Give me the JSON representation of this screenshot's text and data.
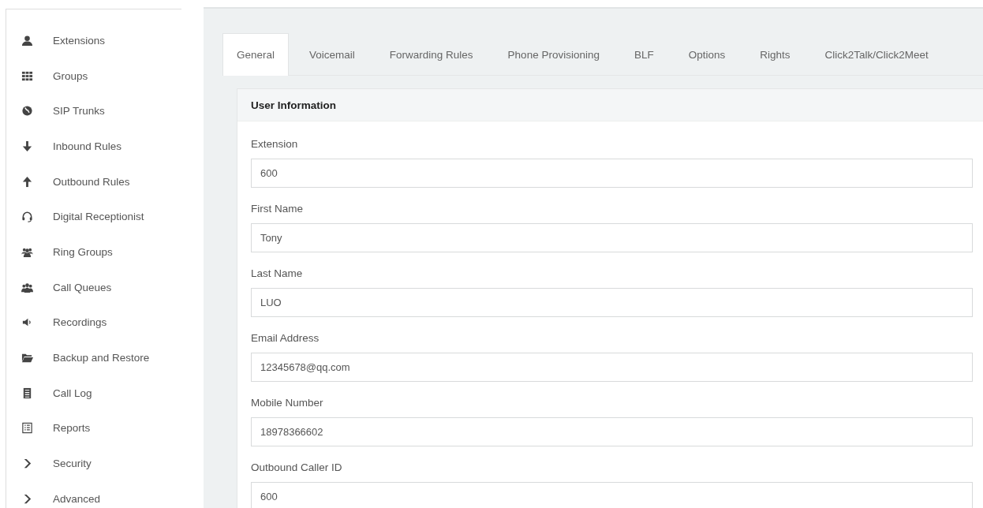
{
  "sidebar": {
    "items": [
      {
        "label": "Extensions"
      },
      {
        "label": "Groups"
      },
      {
        "label": "SIP Trunks"
      },
      {
        "label": "Inbound Rules"
      },
      {
        "label": "Outbound Rules"
      },
      {
        "label": "Digital Receptionist"
      },
      {
        "label": "Ring Groups"
      },
      {
        "label": "Call Queues"
      },
      {
        "label": "Recordings"
      },
      {
        "label": "Backup and Restore"
      },
      {
        "label": "Call Log"
      },
      {
        "label": "Reports"
      },
      {
        "label": "Security",
        "expanded": false
      },
      {
        "label": "Advanced",
        "expanded": false
      }
    ]
  },
  "tabs": [
    {
      "label": "General",
      "selected": true
    },
    {
      "label": "Voicemail",
      "selected": false
    },
    {
      "label": "Forwarding Rules",
      "selected": false
    },
    {
      "label": "Phone Provisioning",
      "selected": false
    },
    {
      "label": "BLF",
      "selected": false
    },
    {
      "label": "Options",
      "selected": false
    },
    {
      "label": "Rights",
      "selected": false
    },
    {
      "label": "Click2Talk/Click2Meet",
      "selected": false
    }
  ],
  "panel": {
    "title": "User Information",
    "fields": [
      {
        "label": "Extension",
        "value": "600"
      },
      {
        "label": "First Name",
        "value": "Tony"
      },
      {
        "label": "Last Name",
        "value": "LUO"
      },
      {
        "label": "Email Address",
        "value": "12345678@qq.com"
      },
      {
        "label": "Mobile Number",
        "value": "18978366602"
      },
      {
        "label": "Outbound Caller ID",
        "value": "600"
      }
    ]
  }
}
